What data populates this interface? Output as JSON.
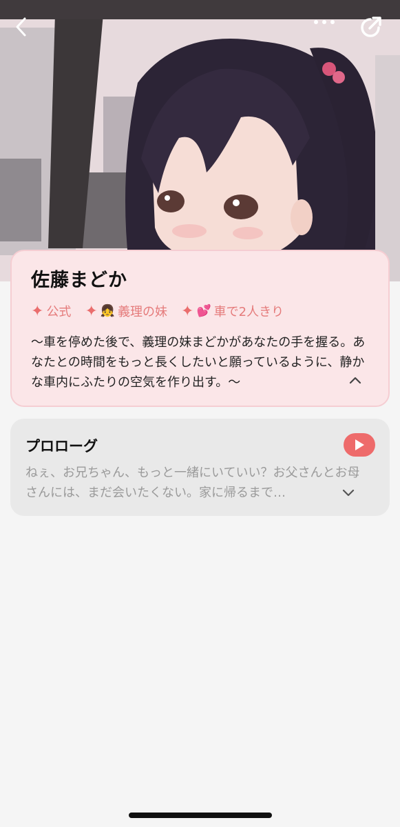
{
  "header": {
    "back_icon": "chevron-left-icon",
    "more_icon": "more-horizontal-icon",
    "share_icon": "share-icon"
  },
  "hero": {
    "image_description_icon": "character-illustration"
  },
  "character": {
    "name": "佐藤まどか",
    "tags": [
      {
        "emoji": "",
        "label": "公式"
      },
      {
        "emoji": "👧",
        "label": "義理の妹"
      },
      {
        "emoji": "💕",
        "label": "車で2人きり"
      }
    ],
    "description": "〜車を停めた後で、義理の妹まどかがあなたの手を握る。あなたとの時間をもっと長くしたいと願っているように、静かな車内にふたりの空気を作り出す。〜"
  },
  "prologue": {
    "title": "プロローグ",
    "text": "ねぇ、お兄ちゃん、もっと一緒にいていい？お父さんとお母さんには、まだ会いたくない。家に帰るまで…"
  },
  "colors": {
    "accent": "#ee6b6b",
    "tag_text": "#e57b7b",
    "card_bg": "#fbe6e8",
    "card_border": "#f5cdd2",
    "prologue_bg": "#e9e9e9",
    "page_bg": "#f5f5f5"
  }
}
